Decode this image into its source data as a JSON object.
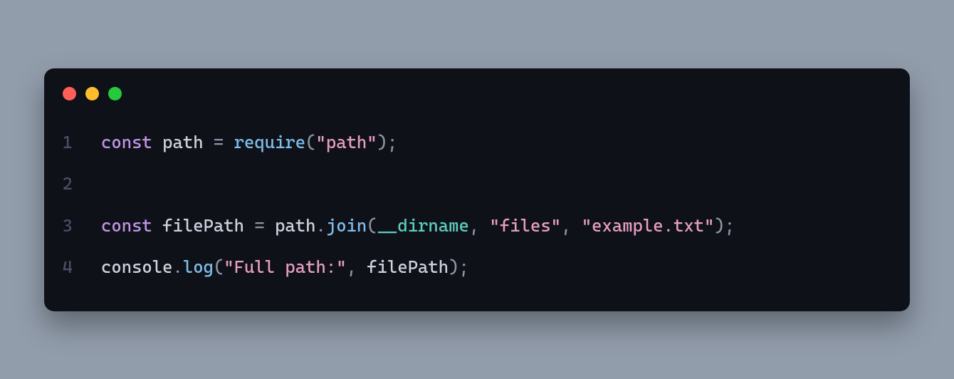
{
  "trafficLights": {
    "redColor": "#ff5f56",
    "yellowColor": "#ffbd2e",
    "greenColor": "#27c93f"
  },
  "code": {
    "lines": [
      {
        "num": "1",
        "tokens": [
          {
            "t": "const ",
            "c": "tok-keyword"
          },
          {
            "t": "path",
            "c": "tok-ident"
          },
          {
            "t": " ",
            "c": "tok-ident"
          },
          {
            "t": "=",
            "c": "tok-punct"
          },
          {
            "t": " ",
            "c": "tok-ident"
          },
          {
            "t": "require",
            "c": "tok-func"
          },
          {
            "t": "(",
            "c": "tok-punct"
          },
          {
            "t": "\"path\"",
            "c": "tok-string"
          },
          {
            "t": ");",
            "c": "tok-punct"
          }
        ]
      },
      {
        "num": "2",
        "tokens": []
      },
      {
        "num": "3",
        "tokens": [
          {
            "t": "const ",
            "c": "tok-keyword"
          },
          {
            "t": "filePath",
            "c": "tok-ident"
          },
          {
            "t": " ",
            "c": "tok-ident"
          },
          {
            "t": "=",
            "c": "tok-punct"
          },
          {
            "t": " ",
            "c": "tok-ident"
          },
          {
            "t": "path",
            "c": "tok-ident"
          },
          {
            "t": ".",
            "c": "tok-punct"
          },
          {
            "t": "join",
            "c": "tok-func"
          },
          {
            "t": "(",
            "c": "tok-punct"
          },
          {
            "t": "__dirname",
            "c": "tok-builtin"
          },
          {
            "t": ", ",
            "c": "tok-punct"
          },
          {
            "t": "\"files\"",
            "c": "tok-string"
          },
          {
            "t": ", ",
            "c": "tok-punct"
          },
          {
            "t": "\"example.txt\"",
            "c": "tok-string"
          },
          {
            "t": ");",
            "c": "tok-punct"
          }
        ]
      },
      {
        "num": "4",
        "tokens": [
          {
            "t": "console",
            "c": "tok-ident"
          },
          {
            "t": ".",
            "c": "tok-punct"
          },
          {
            "t": "log",
            "c": "tok-func"
          },
          {
            "t": "(",
            "c": "tok-punct"
          },
          {
            "t": "\"Full path:\"",
            "c": "tok-string"
          },
          {
            "t": ", ",
            "c": "tok-punct"
          },
          {
            "t": "filePath",
            "c": "tok-ident"
          },
          {
            "t": ");",
            "c": "tok-punct"
          }
        ]
      }
    ]
  }
}
